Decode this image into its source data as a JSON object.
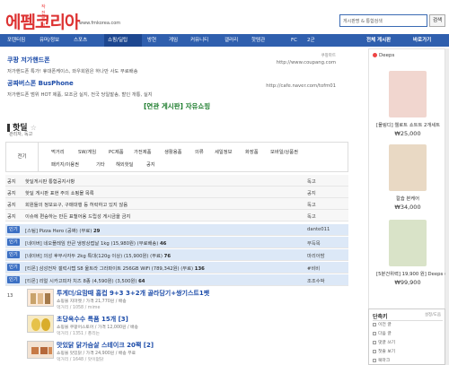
{
  "header": {
    "logo_sub": "작전 펌코",
    "logo_main": "에펨코리아",
    "logo_url": "www.fmkorea.com",
    "search_placeholder": "게시판명 & 통합검색",
    "search_button": "검색"
  },
  "nav": {
    "items": [
      "포텐터짐",
      "유머/정보",
      "스포츠",
      "쇼핑/딜팁",
      "방현",
      "게임",
      "커뮤니티",
      "갤러리",
      "핫템관",
      "FC",
      "2군"
    ],
    "active_index": 3,
    "right": [
      "전체 게시판",
      "바로가기"
    ]
  },
  "ads": [
    {
      "title": "쿠팡 저가핸드폰",
      "desc": "저가핸드폰 특가! 휴대폰케이스, 와우회원은 하나만 사도 무료배송",
      "url": "http://www.coupang.com",
      "label": "쿠팡파트"
    },
    {
      "title": "공짜버스폰 BusPhone",
      "desc": "저가핸드폰 범위 HOT 제품, 보조금 실지, 전국 당일발송, 할인 개통, 실지",
      "url": "http://cafe.naver.com/tofm01",
      "label": ""
    }
  ],
  "related_label": "[연관 게시판] 자유쇼핑",
  "board": {
    "title": "핫딜",
    "star": "☆",
    "subtitle": "관리자, 독고"
  },
  "categories": {
    "all": "전기",
    "row1": [
      "먹거리",
      "SW/게임",
      "PC제품",
      "가전제품",
      "생활용품",
      "의류",
      "세일정보",
      "화장품",
      "모바일/상품권"
    ],
    "row2": [
      "패키지/이용권",
      "기타",
      "해외핫딜",
      "공지"
    ]
  },
  "notices": [
    {
      "tag": "공지",
      "subject": "핫딜게시판 통합공지사항",
      "author": "독고"
    },
    {
      "tag": "공지",
      "subject": "핫딜 게시판 표현 주의 쇼핑몰 목록",
      "author": "공지"
    },
    {
      "tag": "공지",
      "subject": "회원들의 정보요구, 구매대행 등 허락하고 있지 않음",
      "author": "독고"
    },
    {
      "tag": "공지",
      "subject": "이슈에 편승하는 만든 표헐어용 드립성 게시금을 금지",
      "author": "독고"
    }
  ],
  "hot_rows": [
    {
      "tag": "인기",
      "subject": "[스팀] Pizza Hero (공짜) (무료)",
      "count": "29",
      "author": "dante011"
    },
    {
      "tag": "인기",
      "subject": "[네이버] 네오플레임 한큰 냉장상접날 1kg (15,980원) (무료배송)",
      "count": "46",
      "author": "무득목"
    },
    {
      "tag": "인기",
      "subject": "[네이버] 의성 후무사자두 2kg 특대(120g 이상) (15,900원) (무료)",
      "count": "76",
      "author": "마리아밤"
    },
    {
      "tag": "인기",
      "subject": "[티몬] 삼성전자 갤럭시탭 S8 울트라 그라파이트 256GB WiFi (789,342원) (무료)",
      "count": "136",
      "author": "#비비"
    },
    {
      "tag": "인기",
      "subject": "[티몬] 리얼 시카고피자 치즈 8종 (4,590원) (3,500원)",
      "count": "64",
      "author": "조조수박"
    }
  ],
  "posts": [
    {
      "num": "13",
      "title": "투게더/요맘때 홈컵 9+3 3+2개 골라담기+쌍기스트1팻",
      "meta": "쇼핑몰 지마켓 / 가격 21,770원 / 배송",
      "meta2": "먹거리 / 1058 / mime"
    },
    {
      "num": "",
      "title": "초당옥수수 특품 15개 [3]",
      "meta": "쇼핑몰 쿠팡어스토어 / 가격 12,000원 / 배송",
      "meta2": "먹거리 / 1351 / 풍리는"
    },
    {
      "num": "",
      "title": "맛있닭 닭가슴살 스테이크 20팩 [2]",
      "meta": "쇼핑몰 맛있닭 / 가격 24,900원 / 배송 무료",
      "meta2": "먹거리 / 1648 / 맛이없닭"
    }
  ],
  "sidebar": {
    "head": "Deeps",
    "products": [
      {
        "name": "[몰링디] 웰로트 쇼트트 2개세트",
        "price": "₩25,000",
        "color": "#f1d6cf"
      },
      {
        "name": "칼슘 본케어",
        "price": "₩34,000",
        "color": "#e9d9c4"
      },
      {
        "name": "[5분건위력] 19,900 원] Deeps 숙립...",
        "price": "₩99,900",
        "color": "#d9e3c8"
      }
    ]
  },
  "quick": {
    "title": "단축키",
    "more": "설정/도움",
    "rows": [
      "이전 글",
      "다음 글",
      "댓글 쓰기",
      "첫줄 보기",
      "북마크"
    ]
  }
}
